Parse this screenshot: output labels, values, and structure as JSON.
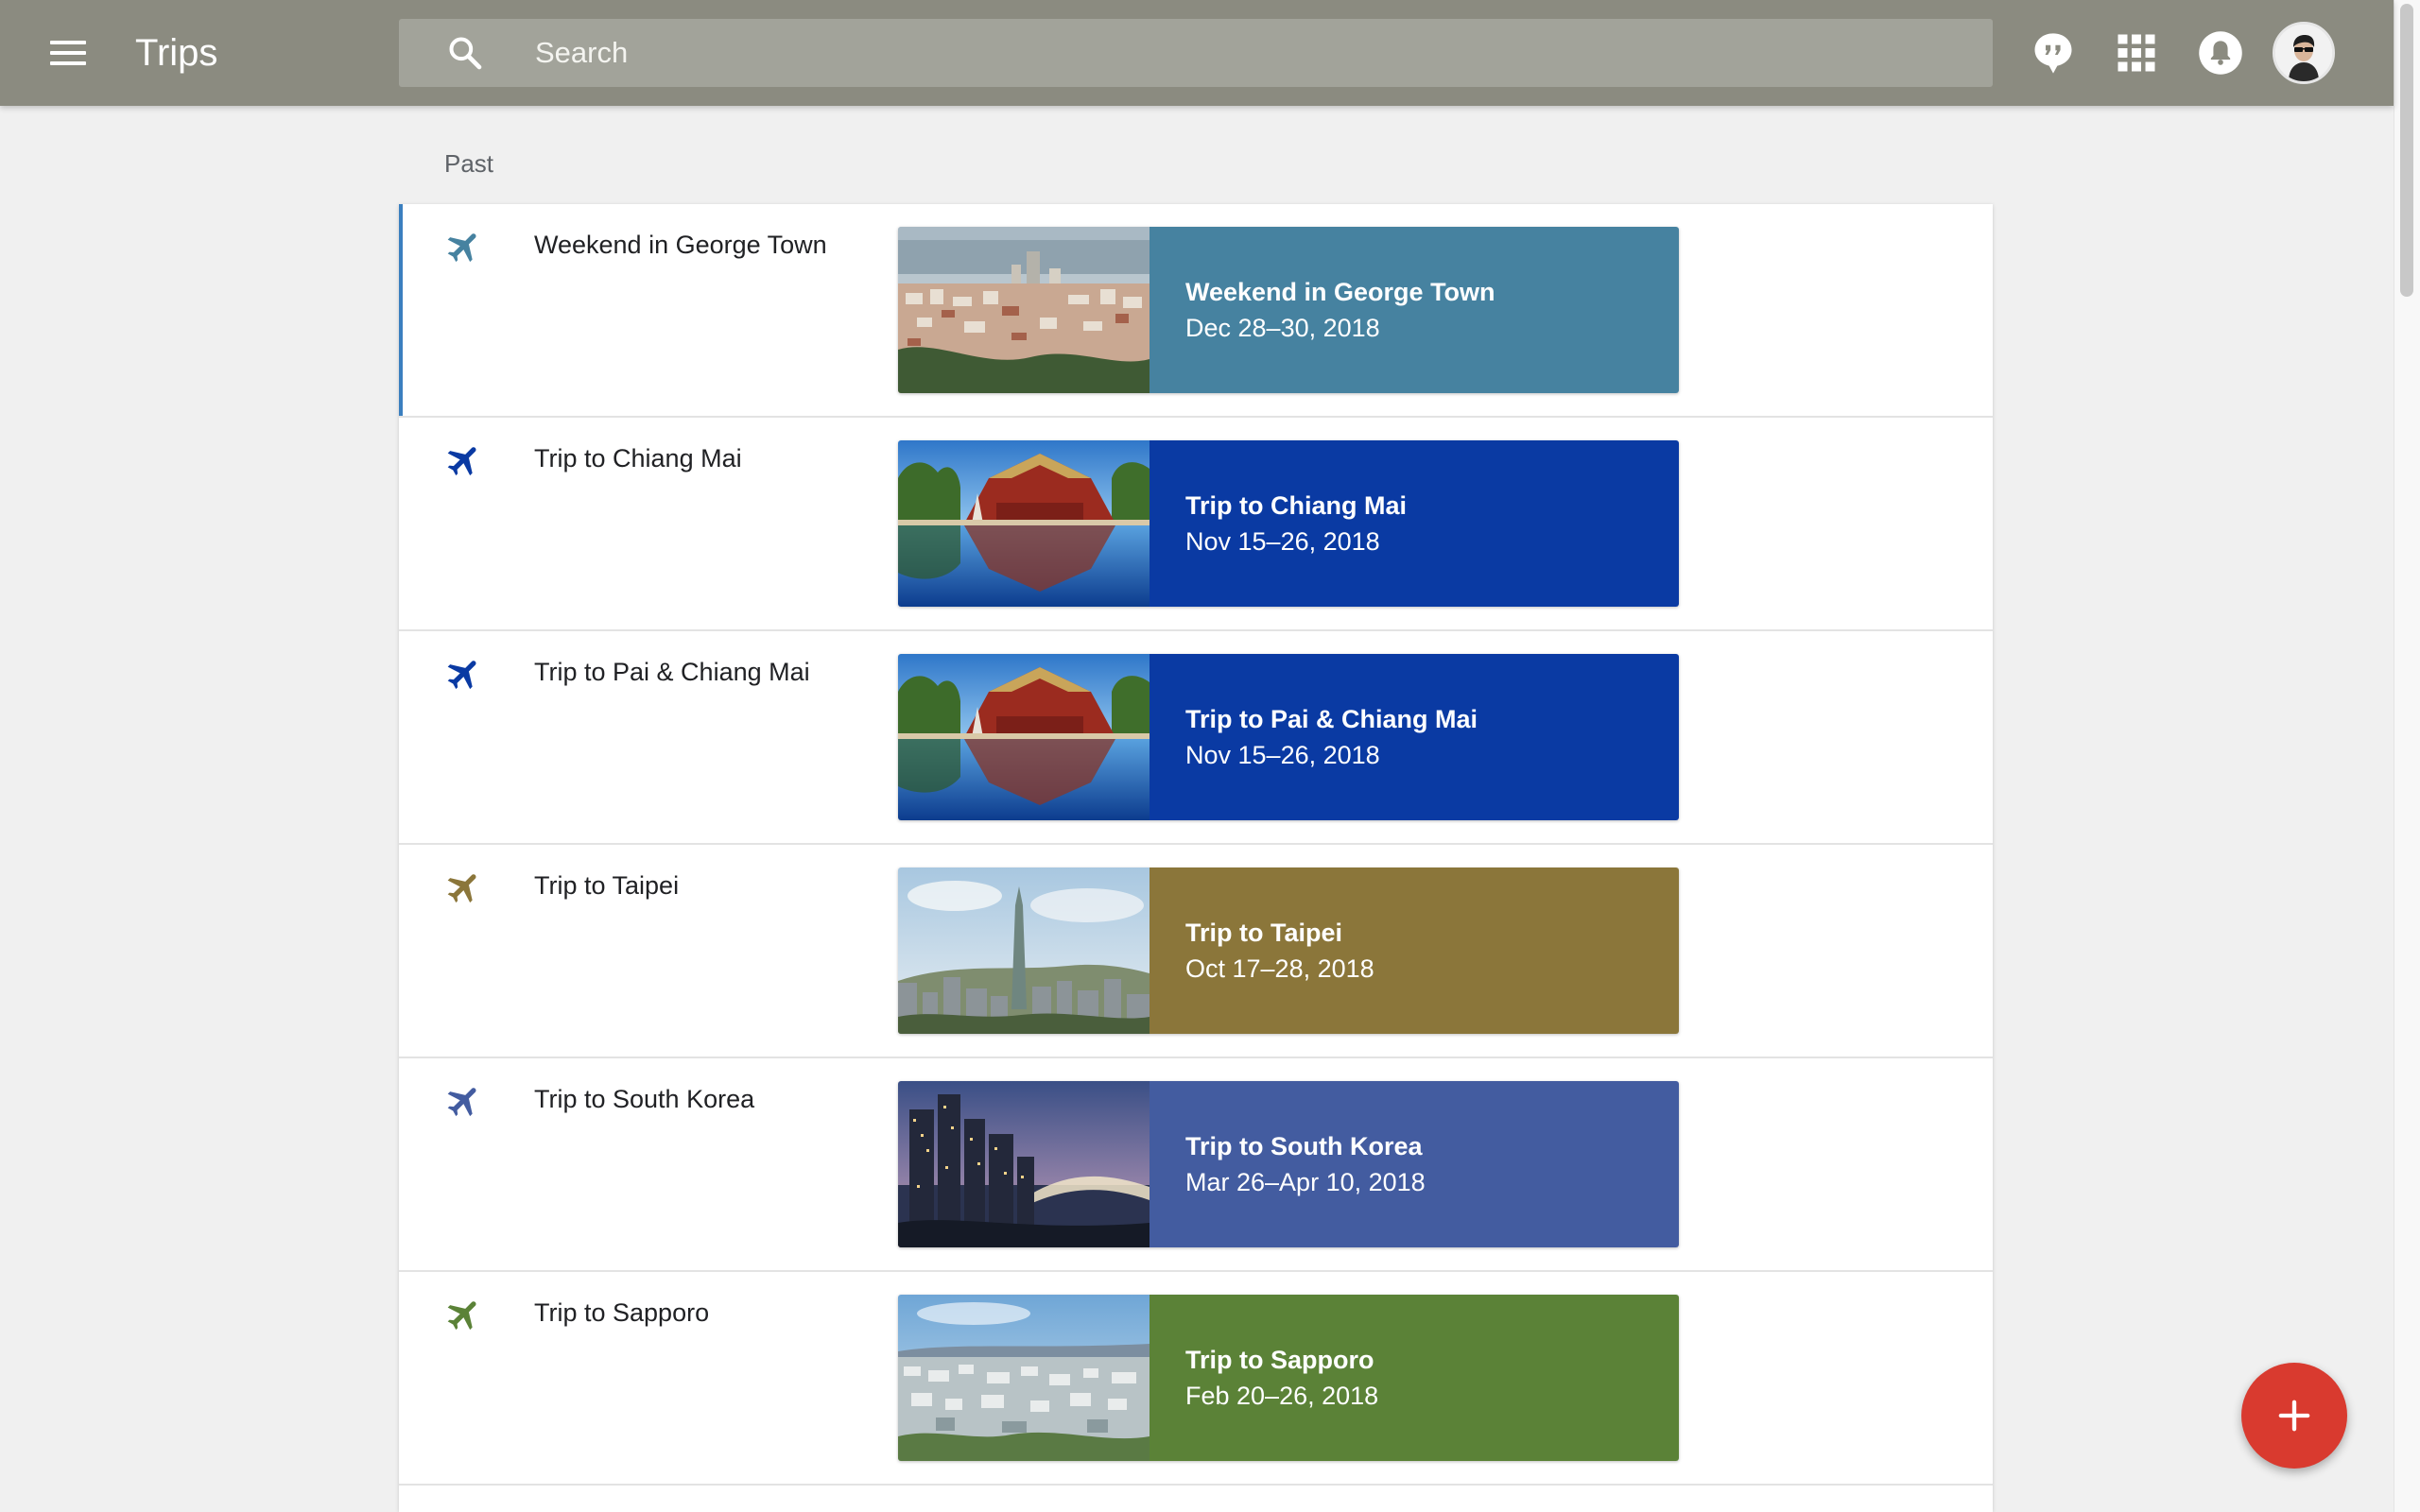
{
  "app": {
    "title": "Trips",
    "menu_icon": "hamburger-menu-icon"
  },
  "search": {
    "placeholder": "Search",
    "value": "",
    "icon": "search-icon"
  },
  "header_actions": {
    "feedback_icon": "feedback-icon",
    "apps_icon": "apps-grid-icon",
    "notifications_icon": "notifications-bell-icon",
    "avatar_icon": "user-avatar"
  },
  "section": {
    "label": "Past"
  },
  "trips": [
    {
      "name": "Weekend in George Town",
      "title": "Weekend in George Town",
      "dates": "Dec 28–30, 2018",
      "color": "#4682a0",
      "icon": "airplane-icon",
      "photo": "city-bay-photo",
      "selected": true
    },
    {
      "name": "Trip to Chiang Mai",
      "title": "Trip to Chiang Mai",
      "dates": "Nov 15–26, 2018",
      "color": "#0a3aa3",
      "icon": "airplane-icon",
      "photo": "temple-reflection-photo",
      "selected": false
    },
    {
      "name": "Trip to Pai & Chiang Mai",
      "title": "Trip to Pai & Chiang Mai",
      "dates": "Nov 15–26, 2018",
      "color": "#0a3aa3",
      "icon": "airplane-icon",
      "photo": "temple-reflection-photo",
      "selected": false
    },
    {
      "name": "Trip to Taipei",
      "title": "Trip to Taipei",
      "dates": "Oct 17–28, 2018",
      "color": "#8b763a",
      "icon": "airplane-icon",
      "photo": "taipei-skyline-photo",
      "selected": false
    },
    {
      "name": "Trip to South Korea",
      "title": "Trip to South Korea",
      "dates": "Mar 26–Apr 10, 2018",
      "color": "#435ca0",
      "icon": "airplane-icon",
      "photo": "night-skyline-photo",
      "selected": false
    },
    {
      "name": "Trip to Sapporo",
      "title": "Trip to Sapporo",
      "dates": "Feb 20–26, 2018",
      "color": "#5b8237",
      "icon": "airplane-icon",
      "photo": "city-aerial-photo",
      "selected": false
    }
  ],
  "fab": {
    "icon": "plus-icon"
  }
}
